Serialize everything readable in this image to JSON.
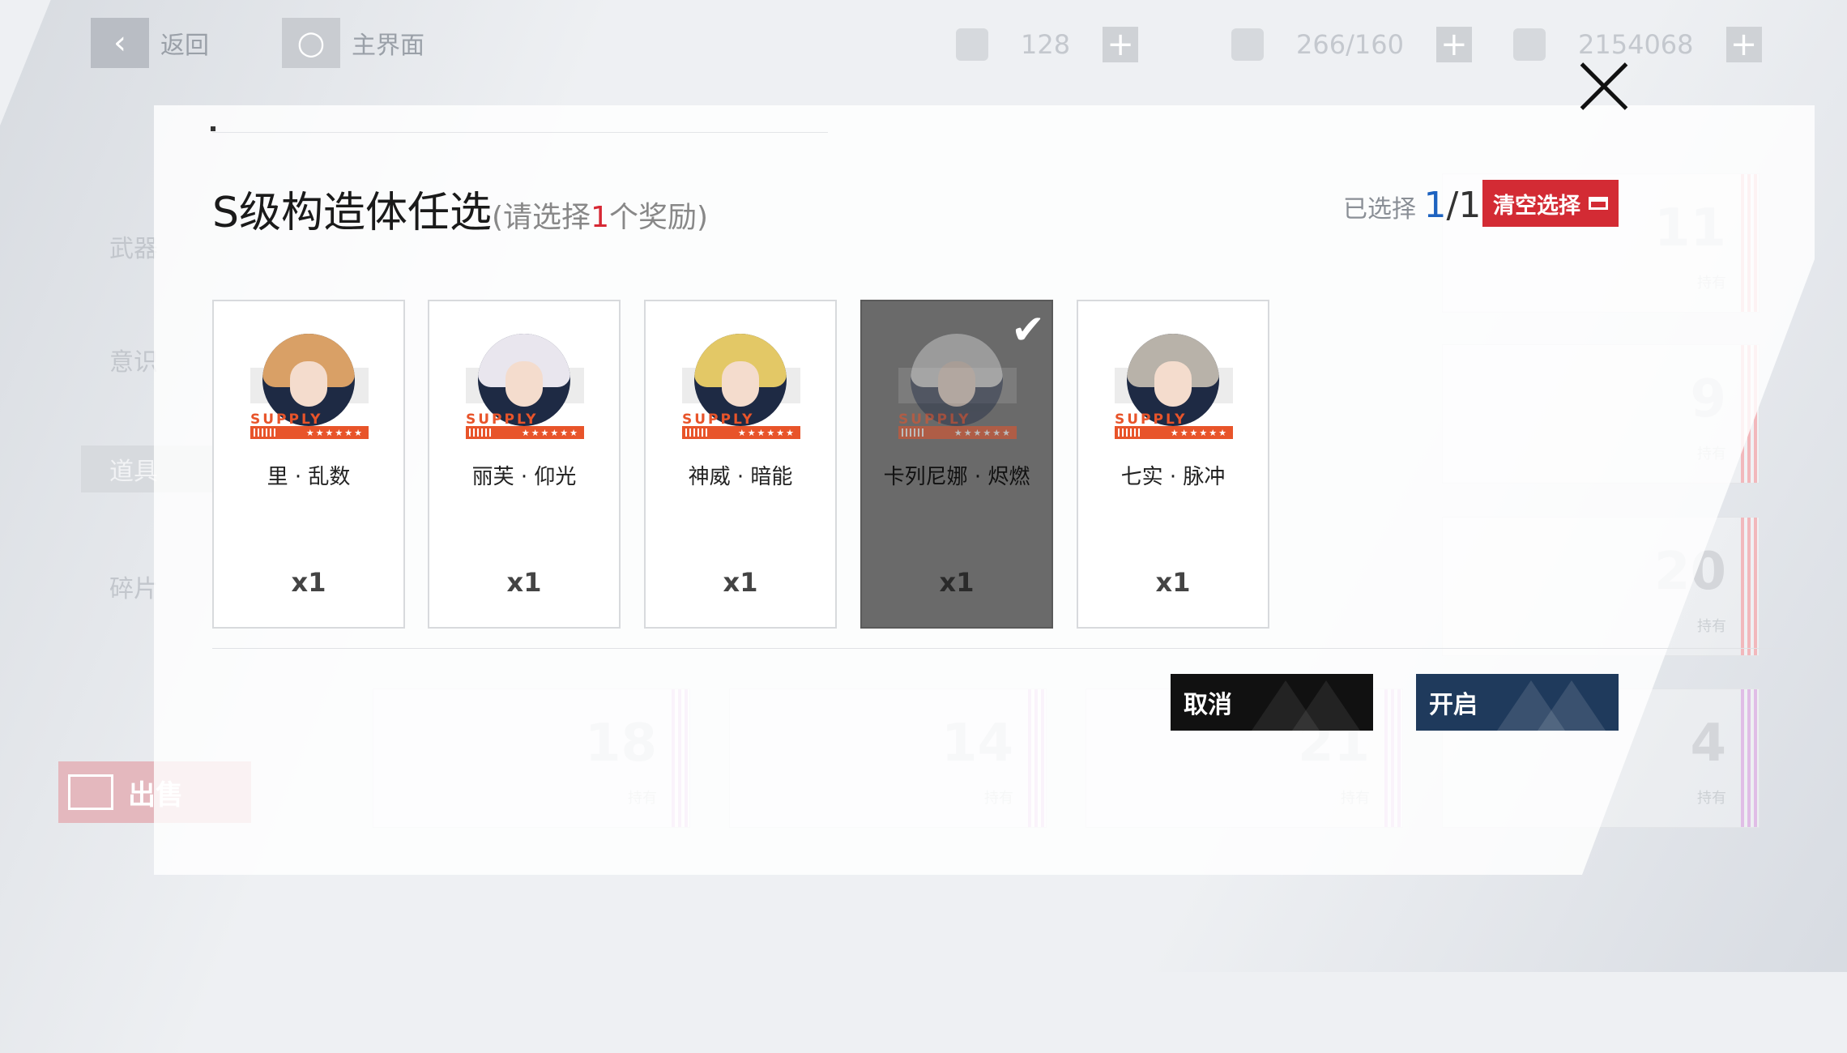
{
  "topbar": {
    "back_label": "返回",
    "home_label": "主界面",
    "resources": [
      {
        "value": "128",
        "icon": "ticket-icon"
      },
      {
        "value": "266/160",
        "icon": "energy-icon"
      },
      {
        "value": "2154068",
        "icon": "coin-icon"
      }
    ]
  },
  "sidebar": {
    "tabs": [
      "武器",
      "意识",
      "道具",
      "碎片"
    ],
    "active_index": 2,
    "sell_label": "出售"
  },
  "background_cards": [
    {
      "count": "11",
      "owned_label": "持有"
    },
    {
      "count": "9",
      "owned_label": "持有"
    },
    {
      "count": "20",
      "owned_label": "持有"
    },
    {
      "count": "4",
      "owned_label": "持有"
    },
    {
      "count": "18",
      "owned_label": "持有"
    },
    {
      "count": "14",
      "owned_label": "持有"
    },
    {
      "count": "21",
      "owned_label": "持有"
    }
  ],
  "dialog": {
    "title": "S级构造体任选",
    "subtitle_prefix": "(请选择",
    "subtitle_count": "1",
    "subtitle_suffix": "个奖励)",
    "selected_label": "已选择",
    "selected_current": "1",
    "selected_total": "/1",
    "clear_label": "清空选择",
    "cancel_label": "取消",
    "confirm_label": "开启",
    "supply_text": "SUPPLY",
    "supply_stars": "★★★★★★",
    "rewards": [
      {
        "name": "里 · 乱数",
        "qty": "x1",
        "selected": false,
        "hair": "#d9a066"
      },
      {
        "name": "丽芙 · 仰光",
        "qty": "x1",
        "selected": false,
        "hair": "#e9e6ee"
      },
      {
        "name": "神威 · 暗能",
        "qty": "x1",
        "selected": false,
        "hair": "#e3c866"
      },
      {
        "name": "卡列尼娜 · 烬燃",
        "qty": "x1",
        "selected": true,
        "hair": "#d8d8d8"
      },
      {
        "name": "七实 · 脉冲",
        "qty": "x1",
        "selected": false,
        "hair": "#b8b2a9"
      }
    ],
    "colors": {
      "accent_red": "#d32b34",
      "supply_orange": "#e8542a",
      "confirm_blue": "#1f3a5c"
    }
  }
}
